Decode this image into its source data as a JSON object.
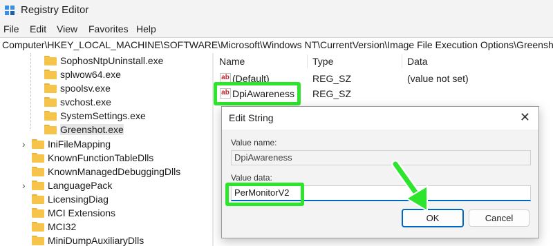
{
  "window": {
    "title": "Registry Editor"
  },
  "menu": [
    "File",
    "Edit",
    "View",
    "Favorites",
    "Help"
  ],
  "address": "Computer\\HKEY_LOCAL_MACHINE\\SOFTWARE\\Microsoft\\Windows NT\\CurrentVersion\\Image File Execution Options\\Greenshot.exe",
  "tree": {
    "items": [
      {
        "label": "SophosNtpUninstall.exe",
        "expandable": false,
        "selected": false
      },
      {
        "label": "splwow64.exe",
        "expandable": false,
        "selected": false
      },
      {
        "label": "spoolsv.exe",
        "expandable": false,
        "selected": false
      },
      {
        "label": "svchost.exe",
        "expandable": false,
        "selected": false
      },
      {
        "label": "SystemSettings.exe",
        "expandable": false,
        "selected": false
      },
      {
        "label": "Greenshot.exe",
        "expandable": false,
        "selected": true
      },
      {
        "label": "IniFileMapping",
        "expandable": true,
        "selected": false
      },
      {
        "label": "KnownFunctionTableDlls",
        "expandable": false,
        "selected": false
      },
      {
        "label": "KnownManagedDebuggingDlls",
        "expandable": false,
        "selected": false
      },
      {
        "label": "LanguagePack",
        "expandable": true,
        "selected": false
      },
      {
        "label": "LicensingDiag",
        "expandable": false,
        "selected": false
      },
      {
        "label": "MCI Extensions",
        "expandable": false,
        "selected": false
      },
      {
        "label": "MCI32",
        "expandable": false,
        "selected": false
      },
      {
        "label": "MiniDumpAuxiliaryDlls",
        "expandable": false,
        "selected": false
      }
    ]
  },
  "values": {
    "columns": [
      "Name",
      "Type",
      "Data"
    ],
    "rows": [
      {
        "name": "(Default)",
        "type": "REG_SZ",
        "data": "(value not set)",
        "icon": "string-value-icon"
      },
      {
        "name": "DpiAwareness",
        "type": "REG_SZ",
        "data": "",
        "icon": "string-value-icon"
      }
    ]
  },
  "dialog": {
    "title": "Edit String",
    "value_name_label": "Value name:",
    "value_name": "DpiAwareness",
    "value_data_label": "Value data:",
    "value_data": "PerMonitorV2",
    "ok_label": "OK",
    "cancel_label": "Cancel"
  },
  "colors": {
    "highlight": "#2ee52e",
    "accent": "#0067c0",
    "folder": "#f6c34b"
  }
}
